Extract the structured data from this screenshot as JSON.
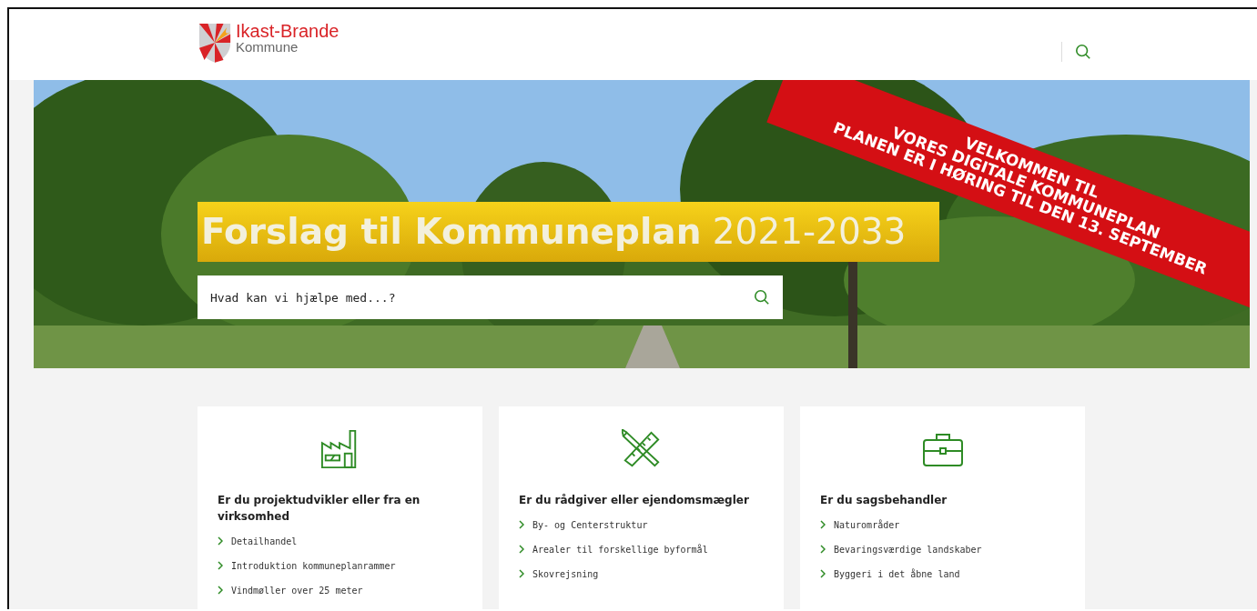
{
  "header": {
    "logo": {
      "name": "Ikast-Brande",
      "subtitle": "Kommune"
    }
  },
  "hero": {
    "title": "**Forslag til Kommuneplan** 2021-2033",
    "ribbon": [
      "VELKOMMEN TIL",
      "VORES DIGITALE KOMMUNEPLAN",
      "PLANEN ER I HØRING TIL DEN 13. SEPTEMBER"
    ],
    "search": {
      "placeholder": "Hvad kan vi hjælpe med...?"
    }
  },
  "cards": [
    {
      "title": "Er du projektudvikler eller fra en virksomhed",
      "links": [
        "Detailhandel",
        "Introduktion kommuneplanrammer",
        "Vindmøller over 25 meter"
      ]
    },
    {
      "title": "Er du rådgiver eller ejendomsmægler",
      "links": [
        "By- og Centerstruktur",
        "Arealer til forskellige byformål",
        "Skovrejsning"
      ]
    },
    {
      "title": "Er du sagsbehandler",
      "links": [
        "Naturområder",
        "Bevaringsværdige landskaber",
        "Byggeri i det åbne land"
      ]
    }
  ]
}
